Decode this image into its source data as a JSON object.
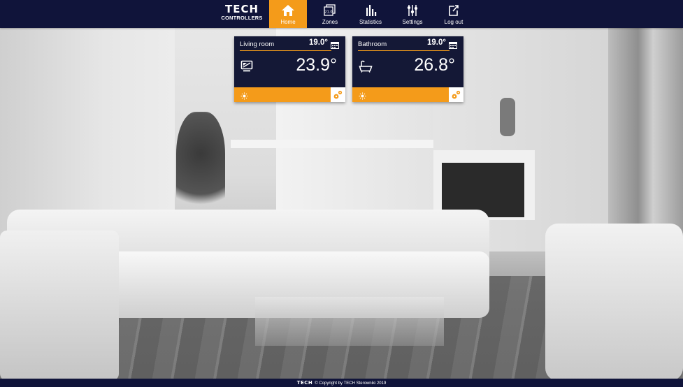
{
  "brand": {
    "logo": "TECH",
    "subtitle": "CONTROLLERS"
  },
  "nav": {
    "items": [
      {
        "label": "Home",
        "icon": "home-icon",
        "active": true
      },
      {
        "label": "Zones",
        "icon": "zones-icon",
        "active": false
      },
      {
        "label": "Statistics",
        "icon": "statistics-icon",
        "active": false
      },
      {
        "label": "Settings",
        "icon": "settings-icon",
        "active": false
      },
      {
        "label": "Log out",
        "icon": "logout-icon",
        "active": false
      }
    ]
  },
  "zones": [
    {
      "name": "Living room",
      "set_temp": "19.0°",
      "current_temp": "23.9°",
      "icon": "monitor-icon"
    },
    {
      "name": "Bathroom",
      "set_temp": "19.0°",
      "current_temp": "26.8°",
      "icon": "bathtub-icon"
    }
  ],
  "footer": {
    "logo": "TECH",
    "copyright": "© Copyright by TECH Sterowniki 2019"
  },
  "colors": {
    "navy": "#10143a",
    "tile": "#141836",
    "accent": "#f49b1a"
  }
}
